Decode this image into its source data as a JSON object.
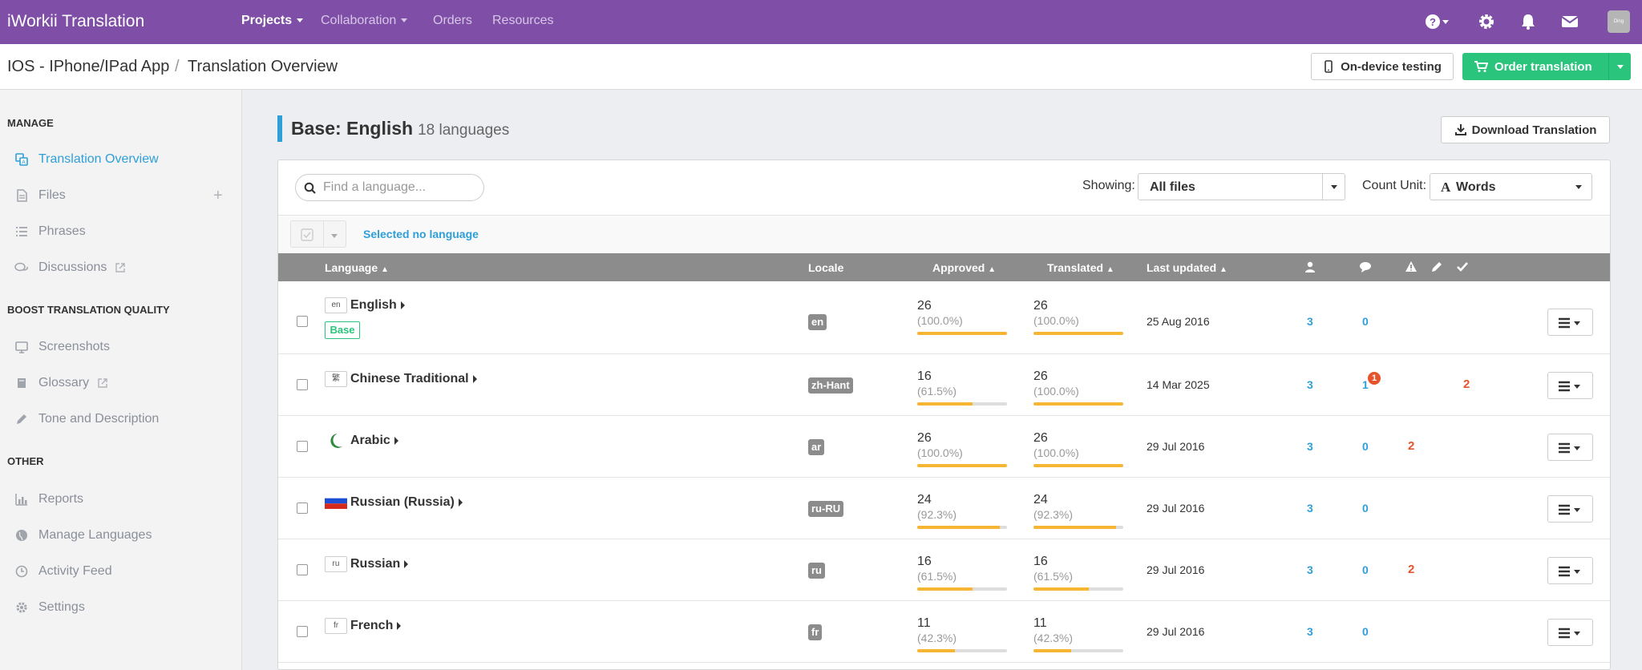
{
  "nav": {
    "brand": "iWorkii Translation",
    "items": [
      {
        "label": "Projects",
        "active": true,
        "caret": true
      },
      {
        "label": "Collaboration",
        "active": false,
        "caret": true
      },
      {
        "label": "Orders",
        "active": false,
        "caret": false
      },
      {
        "label": "Resources",
        "active": false,
        "caret": false
      }
    ],
    "icons": [
      "help-icon",
      "gear-icon",
      "bell-icon",
      "envelope-icon"
    ],
    "avatar_text": "Ding"
  },
  "breadcrumb": {
    "project": "IOS - IPhone/IPad App",
    "separator": "/",
    "page": "Translation Overview"
  },
  "actions": {
    "device_testing": "On-device testing",
    "order_translation": "Order translation",
    "download": "Download Translation"
  },
  "sidebar": {
    "manage_heading": "MANAGE",
    "manage": [
      {
        "label": "Translation Overview",
        "icon": "translate-icon",
        "active": true
      },
      {
        "label": "Files",
        "icon": "file-icon",
        "active": false
      },
      {
        "label": "Phrases",
        "icon": "list-icon",
        "active": false
      },
      {
        "label": "Discussions",
        "icon": "comments-icon",
        "active": false
      }
    ],
    "quality_heading": "BOOST TRANSLATION QUALITY",
    "quality": [
      {
        "label": "Screenshots",
        "icon": "monitor-icon"
      },
      {
        "label": "Glossary",
        "icon": "book-icon"
      },
      {
        "label": "Tone and Description",
        "icon": "pencil-icon"
      }
    ],
    "other_heading": "OTHER",
    "other": [
      {
        "label": "Reports",
        "icon": "chart-icon"
      },
      {
        "label": "Manage Languages",
        "icon": "globe-icon"
      },
      {
        "label": "Activity Feed",
        "icon": "clock-icon"
      },
      {
        "label": "Settings",
        "icon": "gear-icon"
      }
    ]
  },
  "overview": {
    "title": "Base: English",
    "subtitle": "18 languages",
    "search_placeholder": "Find a language...",
    "showing_label": "Showing:",
    "showing_value": "All files",
    "count_unit_label": "Count Unit:",
    "count_unit_value": "Words",
    "selection_text": "Selected no language"
  },
  "table": {
    "headers": {
      "language": "Language",
      "locale": "Locale",
      "approved": "Approved",
      "translated": "Translated",
      "last_updated": "Last updated"
    },
    "rows": [
      {
        "flag": "en",
        "name": "English",
        "base": "Base",
        "locale": "en",
        "approved": "26",
        "approved_pct": "(100.0%)",
        "approved_frac": 1.0,
        "translated": "26",
        "translated_pct": "(100.0%)",
        "translated_frac": 1.0,
        "updated": "25 Aug 2016",
        "users": "3",
        "comments": "0",
        "comment_badge": "",
        "warnings": "",
        "edits": ""
      },
      {
        "flag": "繁",
        "name": "Chinese Traditional",
        "base": "",
        "locale": "zh-Hant",
        "approved": "16",
        "approved_pct": "(61.5%)",
        "approved_frac": 0.615,
        "translated": "26",
        "translated_pct": "(100.0%)",
        "translated_frac": 1.0,
        "updated": "14 Mar 2025",
        "users": "3",
        "comments": "1",
        "comment_badge": "1",
        "warnings": "",
        "edits": "2"
      },
      {
        "flag": "",
        "name": "Arabic",
        "base": "",
        "locale": "ar",
        "approved": "26",
        "approved_pct": "(100.0%)",
        "approved_frac": 1.0,
        "translated": "26",
        "translated_pct": "(100.0%)",
        "translated_frac": 1.0,
        "updated": "29 Jul 2016",
        "users": "3",
        "comments": "0",
        "comment_badge": "",
        "warnings": "2",
        "edits": ""
      },
      {
        "flag": "",
        "name": "Russian (Russia)",
        "base": "",
        "locale": "ru-RU",
        "approved": "24",
        "approved_pct": "(92.3%)",
        "approved_frac": 0.923,
        "translated": "24",
        "translated_pct": "(92.3%)",
        "translated_frac": 0.923,
        "updated": "29 Jul 2016",
        "users": "3",
        "comments": "0",
        "comment_badge": "",
        "warnings": "",
        "edits": ""
      },
      {
        "flag": "ru",
        "name": "Russian",
        "base": "",
        "locale": "ru",
        "approved": "16",
        "approved_pct": "(61.5%)",
        "approved_frac": 0.615,
        "translated": "16",
        "translated_pct": "(61.5%)",
        "translated_frac": 0.615,
        "updated": "29 Jul 2016",
        "users": "3",
        "comments": "0",
        "comment_badge": "",
        "warnings": "2",
        "edits": ""
      },
      {
        "flag": "fr",
        "name": "French",
        "base": "",
        "locale": "fr",
        "approved": "11",
        "approved_pct": "(42.3%)",
        "approved_frac": 0.423,
        "translated": "11",
        "translated_pct": "(42.3%)",
        "translated_frac": 0.423,
        "updated": "29 Jul 2016",
        "users": "3",
        "comments": "0",
        "comment_badge": "",
        "warnings": "",
        "edits": ""
      }
    ]
  },
  "colors": {
    "nav": "#7f4fa7",
    "accent": "#2f9fd8",
    "green": "#2ac47c",
    "progress": "#f7b534",
    "danger": "#e7532d"
  }
}
